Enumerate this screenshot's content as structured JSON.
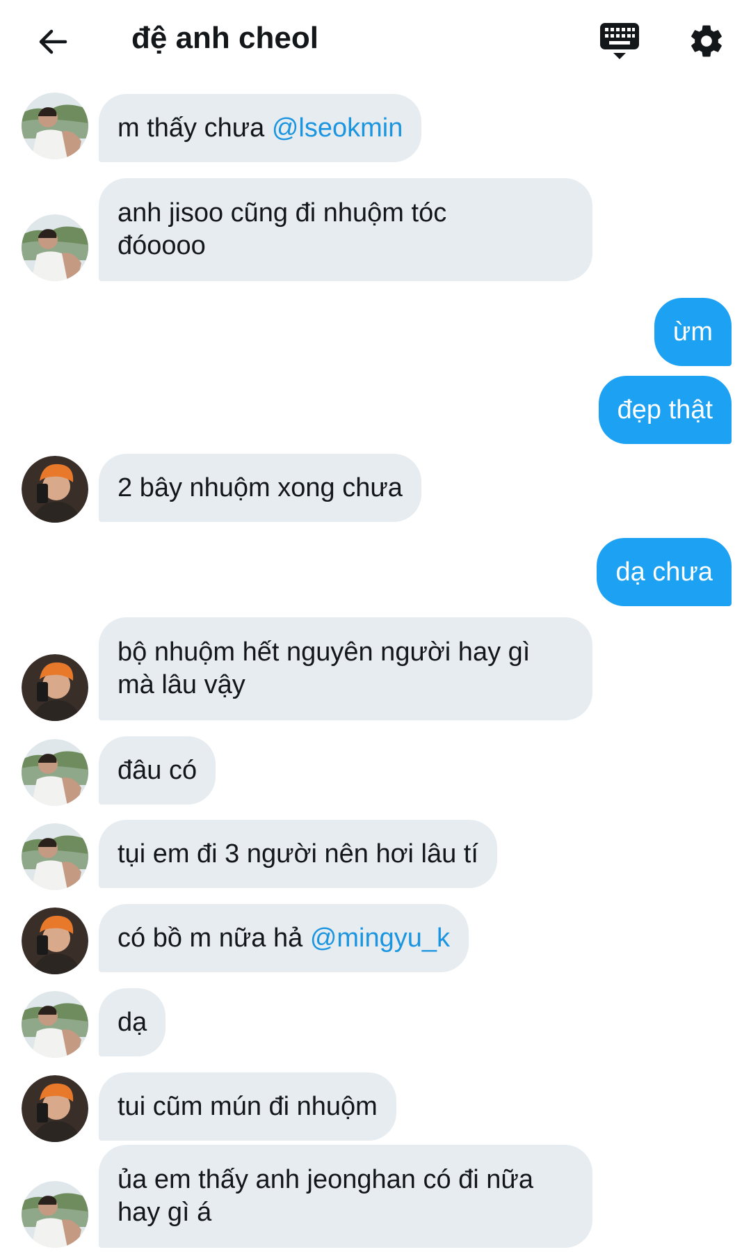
{
  "header": {
    "title": "đệ anh cheol",
    "back_icon": "arrow-left-icon",
    "keyboard_icon": "keyboard-icon",
    "settings_icon": "gear-icon"
  },
  "colors": {
    "incoming_bubble": "#e6ecf0",
    "outgoing_bubble": "#1da1f2",
    "mention": "#1b95e0"
  },
  "messages": [
    {
      "from": "seokmin",
      "direction": "in",
      "text": "m thấy chưa ",
      "mention": "@lseokmin"
    },
    {
      "from": "seokmin",
      "direction": "in",
      "text": "anh jisoo cũng đi nhuộm tóc\nđóoooo"
    },
    {
      "direction": "out",
      "text": "ừm"
    },
    {
      "direction": "out",
      "text": "đẹp thật"
    },
    {
      "from": "mingyu",
      "direction": "in",
      "text": "2 bây nhuộm xong chưa"
    },
    {
      "direction": "out",
      "text": "dạ chưa"
    },
    {
      "from": "mingyu",
      "direction": "in",
      "text": "bộ nhuộm hết nguyên người hay gì\nmà lâu vậy"
    },
    {
      "from": "seokmin",
      "direction": "in",
      "text": "đâu có"
    },
    {
      "from": "seokmin",
      "direction": "in",
      "text": "tụi em đi 3 người nên hơi lâu tí"
    },
    {
      "from": "mingyu",
      "direction": "in",
      "text": "có bồ m nữa hả ",
      "mention": "@mingyu_k"
    },
    {
      "from": "seokmin",
      "direction": "in",
      "text": "dạ"
    },
    {
      "from": "mingyu",
      "direction": "in",
      "text": "tui cũm mún đi nhuộm"
    },
    {
      "from": "seokmin",
      "direction": "in",
      "text": "ủa em thấy anh jeonghan có đi nữa\nhay gì á"
    }
  ]
}
